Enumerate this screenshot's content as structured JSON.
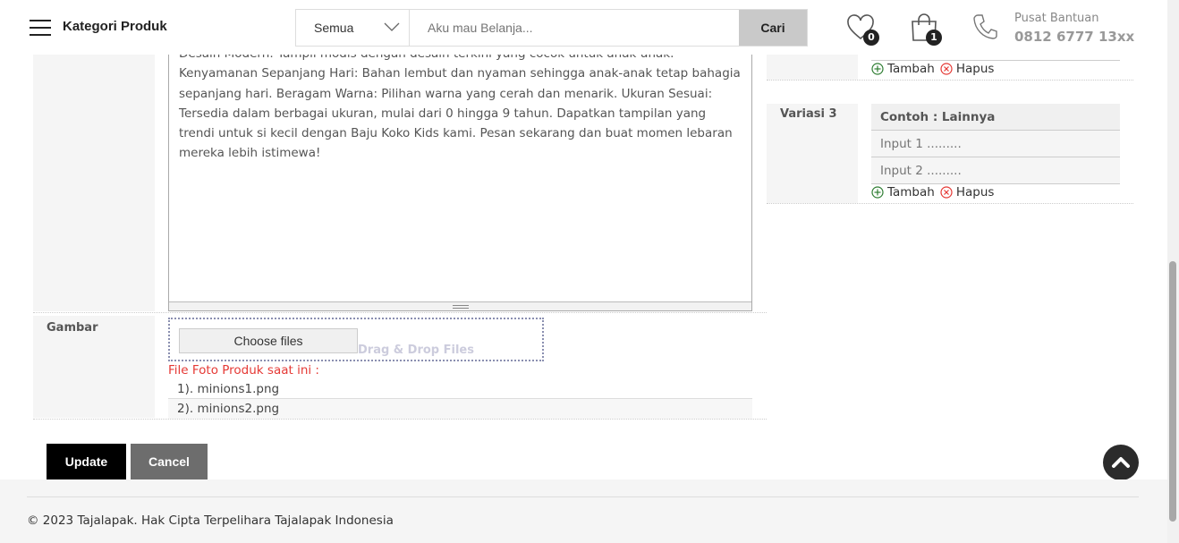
{
  "header": {
    "category_title": "Kategori Produk",
    "search_category": "Semua",
    "search_placeholder": "Aku mau Belanja...",
    "search_button": "Cari",
    "wishlist_count": "0",
    "cart_count": "1",
    "help_label": "Pusat Bantuan",
    "help_phone": "0812 6777 13xx"
  },
  "description": {
    "partial_top_line": "Desain Modern: Tampil modis dengan desain terkini yang cocok untuk anak-anak.",
    "lines": [
      "Kenyamanan Sepanjang Hari: Bahan lembut dan nyaman sehingga anak-anak tetap bahagia",
      "sepanjang hari. Beragam Warna: Pilihan warna yang cerah dan menarik. Ukuran Sesuai:",
      "Tersedia dalam berbagai ukuran, mulai dari 0 hingga 9 tahun. Dapatkan tampilan yang",
      "trendi untuk si kecil dengan Baju Koko Kids kami. Pesan sekarang dan buat momen lebaran",
      "mereka lebih istimewa!"
    ]
  },
  "gambar": {
    "label": "Gambar",
    "choose_files": "Choose files",
    "drag_drop": "Drag & Drop Files",
    "current_label": "File Foto Produk saat ini :",
    "files": [
      "1). minions1.png",
      "2). minions2.png"
    ]
  },
  "variations": {
    "add_label": "Tambah",
    "remove_label": "Hapus",
    "variasi3": {
      "label": "Variasi 3",
      "example": "Contoh : Lainnya",
      "input1_placeholder": "Input 1 .........",
      "input2_placeholder": "Input 2 ........."
    }
  },
  "actions": {
    "update": "Update",
    "cancel": "Cancel"
  },
  "footer": {
    "copyright": "© 2023 Tajalapak. Hak Cipta Terpelihara Tajalapak Indonesia"
  },
  "colors": {
    "accent_red": "#e53935",
    "add_green": "#2e7d32",
    "remove_red": "#e53935"
  }
}
